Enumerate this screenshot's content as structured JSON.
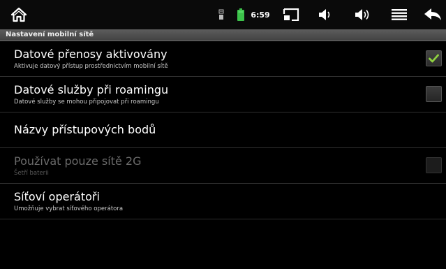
{
  "status_bar": {
    "time": "6:59",
    "icons": [
      "home-icon",
      "usb-icon",
      "battery-icon",
      "screenshot-icon",
      "volume-down-icon",
      "volume-up-icon",
      "menu-icon",
      "back-icon"
    ],
    "battery_color": "#3cc24a"
  },
  "title_bar": {
    "title": "Nastavení mobilní sítě"
  },
  "settings": [
    {
      "title": "Datové přenosy aktivovány",
      "summary": "Aktivuje datový přístup prostřednictvím mobilní sítě",
      "checkbox": true,
      "checked": true,
      "enabled": true
    },
    {
      "title": "Datové služby při roamingu",
      "summary": "Datové služby se mohou připojovat při roamingu",
      "checkbox": true,
      "checked": false,
      "enabled": true
    },
    {
      "title": "Názvy přístupových bodů",
      "summary": "",
      "checkbox": false,
      "enabled": true
    },
    {
      "title": "Používat pouze sítě 2G",
      "summary": "Šetří baterii",
      "checkbox": true,
      "checked": false,
      "enabled": false
    },
    {
      "title": "Síťoví operátoři",
      "summary": "Umožňuje vybrat síťového operátora",
      "checkbox": false,
      "enabled": true
    }
  ],
  "colors": {
    "check_mark": "#8fd140",
    "background": "#000000",
    "title_bar": "#4e4e4e"
  }
}
